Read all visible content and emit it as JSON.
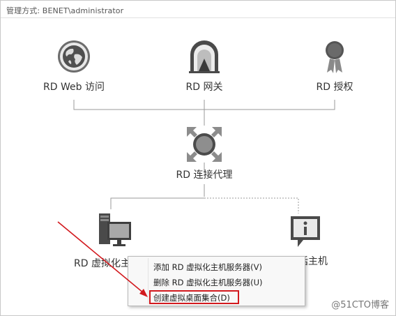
{
  "header": {
    "text": "管理方式: BENET\\administrator"
  },
  "nodes": {
    "rd_web": "RD Web 访问",
    "rd_gateway": "RD 网关",
    "rd_license": "RD 授权",
    "broker": "RD 连接代理",
    "vh_host_partial": "RD 虚拟化主",
    "session_host_partial": "话主机"
  },
  "context_menu": {
    "items": [
      "添加 RD 虚拟化主机服务器(V)",
      "删除 RD 虚拟化主机服务器(U)",
      "创建虚拟桌面集合(D)"
    ]
  },
  "icons": {
    "rd_web": "globe-icon",
    "rd_gateway": "gateway-arch-icon",
    "rd_license": "license-ribbon-icon",
    "broker": "connection-broker-icon",
    "vh_host": "virtualization-host-icon",
    "session_host": "session-host-info-icon"
  },
  "colors": {
    "annotation_red": "#d2191e",
    "icon_gray": "#555555"
  },
  "watermark": "@51CTO博客"
}
